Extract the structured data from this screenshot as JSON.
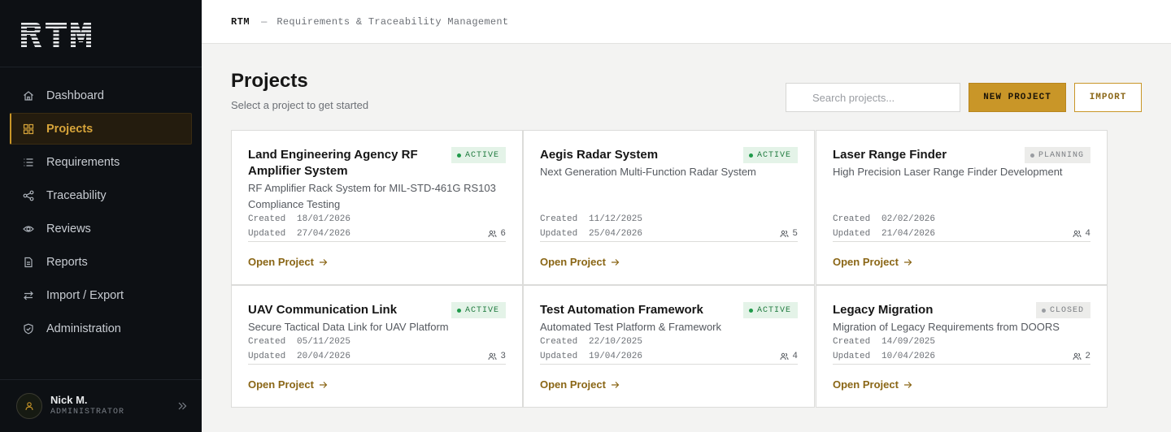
{
  "app": {
    "logo_text": "RTM"
  },
  "topbar": {
    "brand": "RTM",
    "separator": "—",
    "subtitle": "Requirements & Traceability Management"
  },
  "sidebar": {
    "items": [
      {
        "label": "Dashboard",
        "icon": "home-icon",
        "active": false
      },
      {
        "label": "Projects",
        "icon": "grid-icon",
        "active": true
      },
      {
        "label": "Requirements",
        "icon": "list-icon",
        "active": false
      },
      {
        "label": "Traceability",
        "icon": "share-icon",
        "active": false
      },
      {
        "label": "Reviews",
        "icon": "eye-icon",
        "active": false
      },
      {
        "label": "Reports",
        "icon": "document-icon",
        "active": false
      },
      {
        "label": "Import / Export",
        "icon": "swap-icon",
        "active": false
      },
      {
        "label": "Administration",
        "icon": "shield-icon",
        "active": false
      }
    ],
    "user": {
      "name": "Nick M.",
      "role": "ADMINISTRATOR"
    }
  },
  "header": {
    "title": "Projects",
    "subtitle": "Select a project to get started",
    "search_placeholder": "Search projects...",
    "new_button": "NEW PROJECT",
    "import_button": "IMPORT"
  },
  "labels": {
    "created": "Created",
    "updated": "Updated",
    "open": "Open Project"
  },
  "colors": {
    "accent": "#c99628",
    "active_badge": "#1f7a3e",
    "sidebar_bg": "#0d1014"
  },
  "projects": [
    {
      "title": "Land Engineering Agency RF Amplifier System",
      "status": "ACTIVE",
      "description": "RF Amplifier Rack System for MIL-STD-461G RS103 Compliance Testing",
      "created": "18/01/2026",
      "updated": "27/04/2026",
      "members": "6"
    },
    {
      "title": "Aegis Radar System",
      "status": "ACTIVE",
      "description": "Next Generation Multi-Function Radar System",
      "created": "11/12/2025",
      "updated": "25/04/2026",
      "members": "5"
    },
    {
      "title": "Laser Range Finder",
      "status": "PLANNING",
      "description": "High Precision Laser Range Finder Development",
      "created": "02/02/2026",
      "updated": "21/04/2026",
      "members": "4"
    },
    {
      "title": "UAV Communication Link",
      "status": "ACTIVE",
      "description": "Secure Tactical Data Link for UAV Platform",
      "created": "05/11/2025",
      "updated": "20/04/2026",
      "members": "3"
    },
    {
      "title": "Test Automation Framework",
      "status": "ACTIVE",
      "description": "Automated Test Platform & Framework",
      "created": "22/10/2025",
      "updated": "19/04/2026",
      "members": "4"
    },
    {
      "title": "Legacy Migration",
      "status": "CLOSED",
      "description": "Migration of Legacy Requirements from DOORS",
      "created": "14/09/2025",
      "updated": "10/04/2026",
      "members": "2"
    }
  ]
}
